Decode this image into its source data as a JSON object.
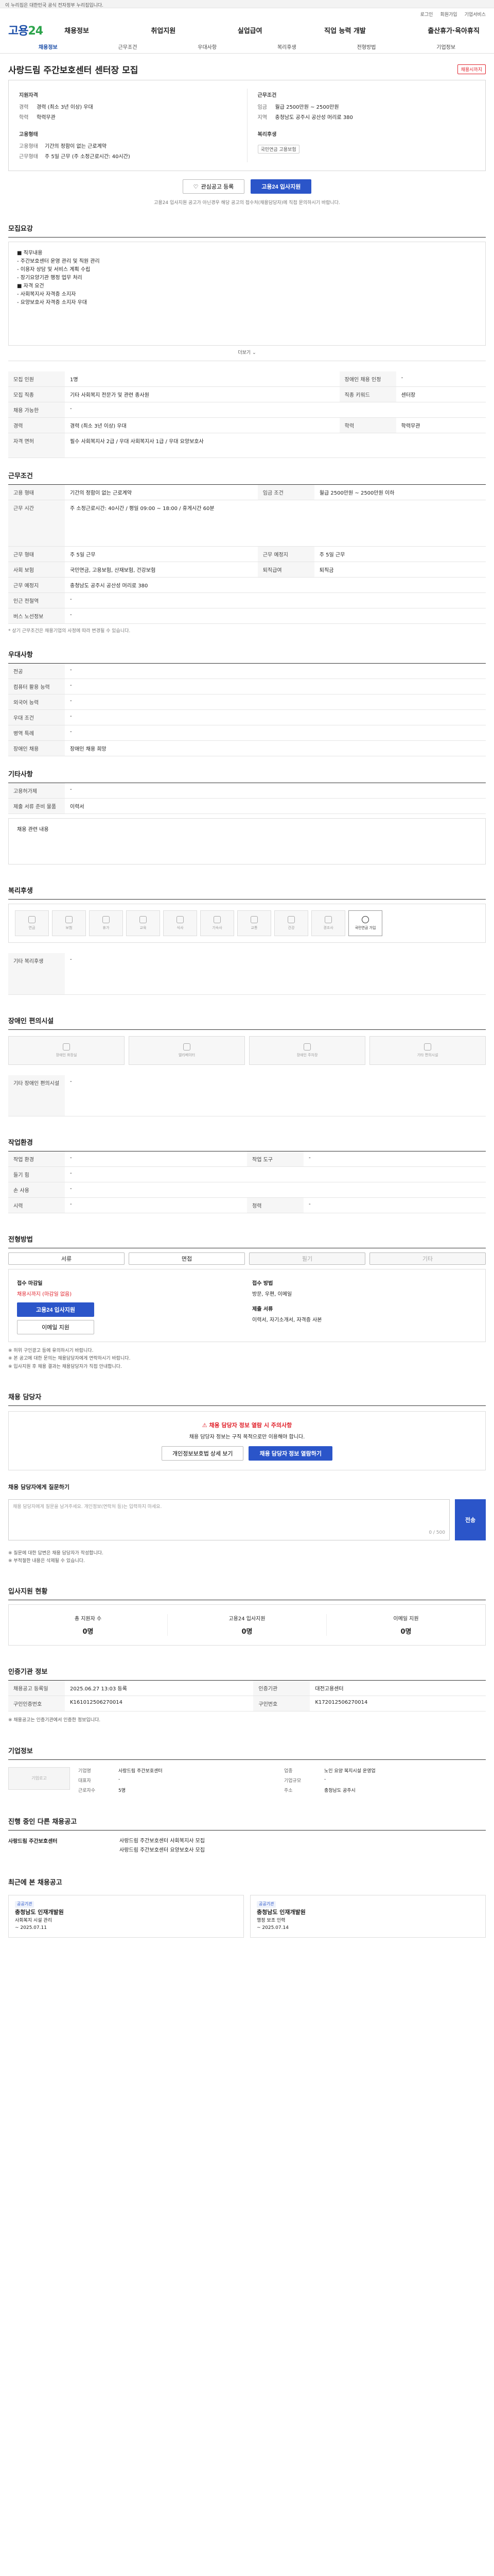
{
  "gov_bar": "이 누리집은 대한민국 공식 전자정부 누리집입니다.",
  "util": [
    "로그인",
    "회원가입",
    "기업서비스"
  ],
  "header": {
    "logo_a": "고용",
    "logo_b": "24",
    "gnb": [
      "채용정보",
      "취업지원",
      "실업급여",
      "직업 능력 개발",
      "출산휴가·육아휴직"
    ]
  },
  "subnav": [
    "채용정보",
    "근무조건",
    "우대사항",
    "복리후생",
    "전형방법",
    "기업정보"
  ],
  "job": {
    "title": "사랑드림 주간보호센터 센터장 모집",
    "badge": "채용시까지"
  },
  "summary": {
    "left_title": "지원자격",
    "left": [
      {
        "k": "경력",
        "v": "경력 (최소 3년 이상) 우대"
      },
      {
        "k": "학력",
        "v": "학력무관"
      }
    ],
    "left2_title": "고용형태",
    "left2": [
      {
        "k": "고용형태",
        "v": "기간의 정함이 없는 근로계약"
      },
      {
        "k": "근무형태",
        "v": "주 5일 근무 (주 소정근로시간: 40시간)"
      }
    ],
    "right_title": "근무조건",
    "right": [
      {
        "k": "임금",
        "v": "월급 2500만원 ~ 2500만원"
      },
      {
        "k": "지역",
        "v": "충청남도 공주시 공산성 머리로 380"
      }
    ],
    "right2_title": "복리후생",
    "right2_tag": "국민연금 고용보험"
  },
  "buttons": {
    "scrap": "관심공고 등록",
    "apply": "고용24 입사지원"
  },
  "small_notice": "고용24 입사지원 공고가 아닌경우 해당 공고의 접수처(채용담당자)에 직접 문의하시기 바랍니다.",
  "sections": {
    "recruit": "모집요강",
    "work": "근무조건",
    "prefer": "우대사항",
    "etc": "기타사항",
    "welfare": "복리후생",
    "disabled": "장애인 편의시설",
    "work_env": "작업환경",
    "process": "전형방법",
    "agent": "채용 담당자",
    "inquiry": "채용 담당자에게 질문하기",
    "status": "입사지원 현황",
    "reg": "인증기관 정보",
    "company": "기업정보",
    "same": "진행 중인 다른 채용공고",
    "recent": "최근에 본 채용공고"
  },
  "recruit_text": [
    "■ 직무내용",
    "- 주간보호센터 운영 관리 및 직원 관리",
    "- 이용자 상담 및 서비스 계획 수립",
    "- 장기요양기관 행정 업무 처리",
    "■ 자격 요건",
    "- 사회복지사 자격증 소지자",
    "- 요양보호사 자격증 소지자 우대"
  ],
  "more": "더보기",
  "recruit_table": [
    {
      "k": "모집 인원",
      "v": "1명",
      "k2": "장애인 채용 인정",
      "v2": "-"
    },
    {
      "k": "모집 직종",
      "v": "기타 사회복지 전문가 및 관련 종사원",
      "k2": "직종 키워드",
      "v2": "센터장"
    },
    {
      "k": "채용 가능한",
      "v": "-",
      "k2": "",
      "v2": ""
    },
    {
      "k": "경력",
      "v": "경력 (최소 3년 이상) 우대",
      "k2": "학력",
      "v2": "학력무관"
    },
    {
      "k": "자격 면허",
      "v": "필수 사회복지사 2급 / 우대 사회복지사 1급 / 우대 요양보호사",
      "k2": "",
      "v2": ""
    }
  ],
  "work_table": [
    {
      "k": "고용 형태",
      "v": "기간의 정함이 없는 근로계약",
      "k2": "임금 조건",
      "v2": "월급 2500만원 ~ 2500만원 이하"
    },
    {
      "k": "근무 시간",
      "v": "주 소정근로시간: 40시간 / 평일 09:00 ~ 18:00 / 휴게시간 60분",
      "k2": "",
      "v2": ""
    },
    {
      "k": "근무 형태",
      "v": "주 5일 근무",
      "k2": "근무 예정지",
      "v2": "주 5일 근무"
    },
    {
      "k": "사회 보험",
      "v": "국민연금, 고용보험, 산재보험, 건강보험",
      "k2": "퇴직급여",
      "v2": "퇴직금"
    },
    {
      "k": "근무 예정지",
      "v": "충청남도 공주시 공산성 머리로 380",
      "k2": "",
      "v2": ""
    },
    {
      "k": "인근 전철역",
      "v": "-",
      "k2": "",
      "v2": ""
    },
    {
      "k": "버스 노선정보",
      "v": "-",
      "k2": "",
      "v2": ""
    }
  ],
  "work_note": "* 상기 근무조건은 채용기업의 사정에 따라 변경될 수 있습니다.",
  "prefer_table": [
    {
      "k": "전공",
      "v": "-"
    },
    {
      "k": "컴퓨터 활용 능력",
      "v": "-"
    },
    {
      "k": "외국어 능력",
      "v": "-"
    },
    {
      "k": "우대 조건",
      "v": "-"
    },
    {
      "k": "병역 특례",
      "v": "-"
    },
    {
      "k": "장애인 채용",
      "v": "장애인 채용 희망"
    }
  ],
  "etc_table": [
    {
      "k": "고용허가제",
      "v": "-"
    },
    {
      "k": "제출 서류 준비 물품",
      "v": "이력서"
    }
  ],
  "etc_note": "채용 관련 내용",
  "welfare_items": [
    {
      "label": "연금",
      "on": false
    },
    {
      "label": "보험",
      "on": false
    },
    {
      "label": "휴가",
      "on": false
    },
    {
      "label": "교육",
      "on": false
    },
    {
      "label": "식사",
      "on": false
    },
    {
      "label": "기숙사",
      "on": false
    },
    {
      "label": "교통",
      "on": false
    },
    {
      "label": "건강",
      "on": false
    },
    {
      "label": "경조사",
      "on": false
    },
    {
      "label": "국민연금 가입",
      "on": true
    }
  ],
  "welfare_more_label": "기타 복리후생",
  "disabled_items": [
    "장애인 화장실",
    "엘리베이터",
    "장애인 주차장",
    "기타 편의시설"
  ],
  "disabled_more_label": "기타 장애인 편의시설",
  "env_table": [
    {
      "k": "작업 환경",
      "v": "-",
      "k2": "작업 도구",
      "v2": "-"
    },
    {
      "k": "들기 힘",
      "v": "-",
      "k2": "",
      "v2": ""
    },
    {
      "k": "손 사용",
      "v": "-",
      "k2": "",
      "v2": ""
    },
    {
      "k": "시력",
      "v": "-",
      "k2": "청력",
      "v2": "-"
    }
  ],
  "process_btns": [
    {
      "label": "서류",
      "on": true
    },
    {
      "label": "면접",
      "on": true
    },
    {
      "label": "필기",
      "on": false
    },
    {
      "label": "기타",
      "on": false
    }
  ],
  "apply": {
    "deadline_title": "접수 마감일",
    "deadline": "채용시까지 (마감일 없음)",
    "btn1": "고용24 입사지원",
    "btn2": "이메일 지원",
    "docs_title": "접수 방법",
    "docs": "방문, 우편, 이메일",
    "contact_title": "제출 서류",
    "contact": "이력서, 자기소개서, 자격증 사본"
  },
  "apply_notes": [
    "※ 허위 구인광고 등에 유의하시기 바랍니다.",
    "※ 본 공고에 대한 문의는 채용담당자에게 연락하시기 바랍니다.",
    "※ 입사지원 후 채용 결과는 채용담당자가 직접 안내합니다."
  ],
  "agent": {
    "alert": "채용 담당자 정보 열람 시 주의사항",
    "text": "채용 담당자 정보는 구직 목적으로만 이용해야 합니다.",
    "btn1": "개인정보보호법 상세 보기",
    "btn2": "채용 담당자 정보 열람하기"
  },
  "inquiry": {
    "placeholder": "채용 담당자에게 질문을 남겨주세요. 개인정보(연락처 등)는 입력하지 마세요.",
    "count": "0 / 500",
    "btn": "전송",
    "notes": [
      "※ 질문에 대한 답변은 채용 담당자가 작성합니다.",
      "※ 부적절한 내용은 삭제될 수 있습니다."
    ]
  },
  "status": [
    {
      "label": "총 지원자 수",
      "value": "0명"
    },
    {
      "label": "고용24 입사지원",
      "value": "0명"
    },
    {
      "label": "이메일 지원",
      "value": "0명"
    }
  ],
  "reg_table": [
    {
      "k": "채용공고 등록일",
      "v": "2025.06.27 13:03 등록",
      "k2": "인증기관",
      "v2": "대전고용센터"
    },
    {
      "k": "구인인증번호",
      "v": "K161012506270014",
      "k2": "구인번호",
      "v2": "K172012506270014"
    }
  ],
  "reg_notes": [
    "※ 채용공고는 인증기관에서 인증한 정보입니다."
  ],
  "company": {
    "logo": "기업로고",
    "rows": [
      {
        "k": "기업명",
        "v": "사랑드림 주간보호센터"
      },
      {
        "k": "업종",
        "v": "노인 요양 복지시설 운영업"
      },
      {
        "k": "대표자",
        "v": "-"
      },
      {
        "k": "기업규모",
        "v": "-"
      },
      {
        "k": "근로자수",
        "v": "5명"
      },
      {
        "k": "주소",
        "v": "충청남도 공주시"
      }
    ]
  },
  "same": {
    "company": "사랑드림 주간보호센터",
    "items": [
      "사랑드림 주간보호센터 사회복지사 모집",
      "사랑드림 주간보호센터 요양보호사 모집"
    ]
  },
  "recent": [
    {
      "tag": "공공기관",
      "name": "충청남도 인재개발원",
      "desc": "사회복지 시설 관리",
      "date": "~ 2025.07.11"
    },
    {
      "tag": "공공기관",
      "name": "충청남도 인재개발원",
      "desc": "행정 보조 인력",
      "date": "~ 2025.07.14"
    }
  ]
}
